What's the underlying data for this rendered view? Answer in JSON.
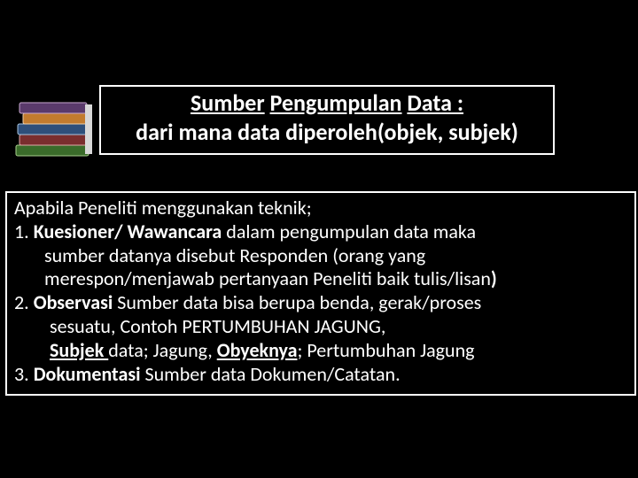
{
  "title": {
    "line1_part1": "Sumber",
    "line1_part2": "Pengumpulan",
    "line1_part3": "Data :",
    "line2": "dari mana data diperoleh(objek, subjek)"
  },
  "body": {
    "l1": "Apabila Peneliti menggunakan teknik;",
    "l2_a": "1.   ",
    "l2_b": "Kuesioner/ Wawancara ",
    "l2_c": "dalam pengumpulan data maka",
    "l3": "sumber datanya disebut Responden (orang yang",
    "l4_a": "merespon/menjawab pertanyaan Peneliti baik tulis/lisan",
    "l4_b": ")",
    "l5_a": "2. ",
    "l5_b": "Observasi ",
    "l5_c": "Sumber data bisa berupa benda, gerak/proses",
    "l6": "sesuatu, Contoh PERTUMBUHAN JAGUNG,",
    "l7_a": "Subjek ",
    "l7_b": "data; Jagung, ",
    "l7_c": "Obyeknya",
    "l7_d": "; Pertumbuhan Jagung",
    "l8_a": "3. ",
    "l8_b": "Dokumentasi ",
    "l8_c": "Sumber data Dokumen/Catatan."
  }
}
